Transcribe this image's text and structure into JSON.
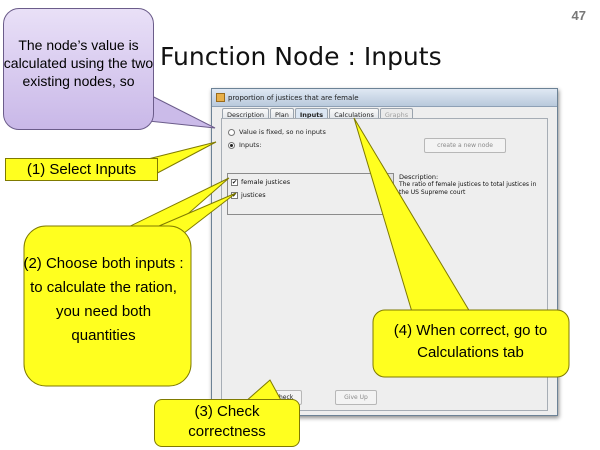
{
  "slide": {
    "number": "47",
    "title": "Function Node : Inputs"
  },
  "window": {
    "title": "proportion of justices that are female",
    "tabs": [
      {
        "label": "Description",
        "state": "normal"
      },
      {
        "label": "Plan",
        "state": "normal"
      },
      {
        "label": "Inputs",
        "state": "active"
      },
      {
        "label": "Calculations",
        "state": "normal"
      },
      {
        "label": "Graphs",
        "state": "disabled"
      }
    ],
    "radio_fixed_label": "Value is fixed, so no inputs",
    "radio_inputs_label": "Inputs:",
    "create_node_button": "create a new node",
    "inputs": [
      {
        "label": "female justices",
        "checked": true
      },
      {
        "label": "justices",
        "checked": true
      }
    ],
    "description_label": "Description:",
    "description_text": "The ratio of female justices to total justices in the US Supreme court",
    "check_button": "Check",
    "give_up_button": "Give Up"
  },
  "callouts": {
    "purple": "The node’s value is calculated using the two existing nodes, so",
    "step1": "(1) Select Inputs",
    "step2": "(2) Choose both inputs : to calculate the ration, you need both quantities",
    "step3": "(3) Check correctness",
    "step4": "(4) When correct, go to Calculations tab"
  },
  "colors": {
    "callout_yellow": "#ffff1f",
    "callout_purple": "#d6c8ef",
    "active_tab": "#dbe6f3"
  }
}
